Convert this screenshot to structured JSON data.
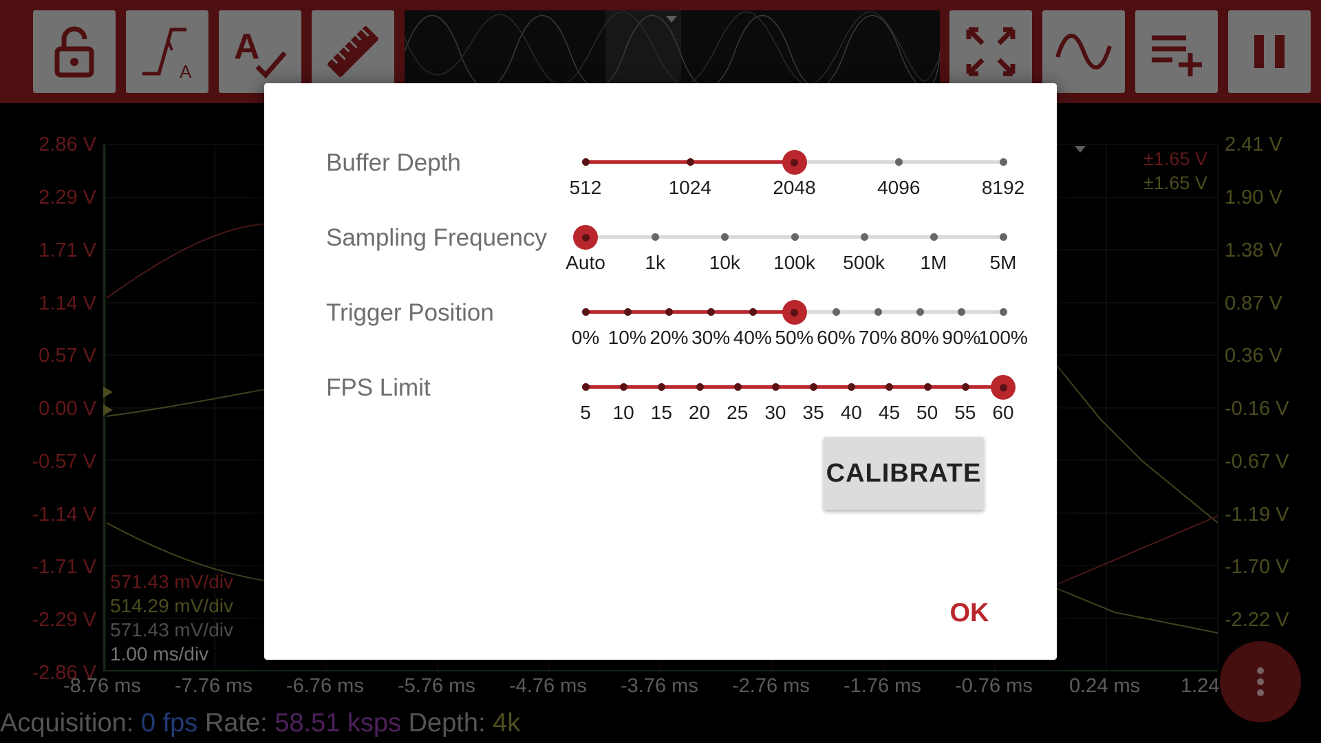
{
  "colors": {
    "toolbar_bg": "#8e1c20",
    "accent": "#b9262c",
    "channel1": "#b42b2e",
    "channel2": "#8b8a3a",
    "fps_value": "#3d6bd6",
    "rate_value": "#8e3ca6",
    "depth_value": "#8f8f3a"
  },
  "toolbar": {
    "buttons_left": [
      {
        "icon": "lock-open-icon"
      },
      {
        "icon": "trigger-auto-icon"
      },
      {
        "icon": "font-check-icon"
      },
      {
        "icon": "ruler-icon"
      }
    ],
    "buttons_right": [
      {
        "icon": "fullscreen-icon"
      },
      {
        "icon": "sine-wave-icon"
      },
      {
        "icon": "playlist-add-icon"
      },
      {
        "icon": "pause-icon"
      }
    ]
  },
  "scope": {
    "left_axis": [
      "2.86 V",
      "2.29 V",
      "1.71 V",
      "1.14 V",
      "0.57 V",
      "0.00 V",
      "-0.57 V",
      "-1.14 V",
      "-1.71 V",
      "-2.29 V",
      "-2.86 V"
    ],
    "right_axis": [
      "2.41 V",
      "1.90 V",
      "1.38 V",
      "0.87 V",
      "0.36 V",
      "-0.16 V",
      "-0.67 V",
      "-1.19 V",
      "-1.70 V",
      "-2.22 V"
    ],
    "time_axis": [
      "-8.76 ms",
      "-7.76 ms",
      "-6.76 ms",
      "-5.76 ms",
      "-4.76 ms",
      "-3.76 ms",
      "-2.76 ms",
      "-1.76 ms",
      "-0.76 ms",
      "0.24 ms",
      "1.24"
    ],
    "div_labels": [
      "571.43 mV/div",
      "514.29 mV/div",
      "571.43 mV/div",
      "1.00 ms/div"
    ],
    "range_labels": [
      "±1.65 V",
      "±1.65 V"
    ]
  },
  "status": {
    "acq_label": "Acquisition:",
    "acq_value": "0 fps",
    "rate_label": "Rate:",
    "rate_value": "58.51 ksps",
    "depth_label": "Depth:",
    "depth_value": "4k"
  },
  "dialog": {
    "settings": [
      {
        "label": "Buffer Depth",
        "ticks": [
          "512",
          "1024",
          "2048",
          "4096",
          "8192"
        ],
        "selected_index": 2
      },
      {
        "label": "Sampling Frequency",
        "ticks": [
          "Auto",
          "1k",
          "10k",
          "100k",
          "500k",
          "1M",
          "5M"
        ],
        "selected_index": 0
      },
      {
        "label": "Trigger Position",
        "ticks": [
          "0%",
          "10%",
          "20%",
          "30%",
          "40%",
          "50%",
          "60%",
          "70%",
          "80%",
          "90%",
          "100%"
        ],
        "selected_index": 5
      },
      {
        "label": "FPS Limit",
        "ticks": [
          "5",
          "10",
          "15",
          "20",
          "25",
          "30",
          "35",
          "40",
          "45",
          "50",
          "55",
          "60"
        ],
        "selected_index": 11
      }
    ],
    "calibrate_label": "CALIBRATE",
    "ok_label": "OK"
  }
}
